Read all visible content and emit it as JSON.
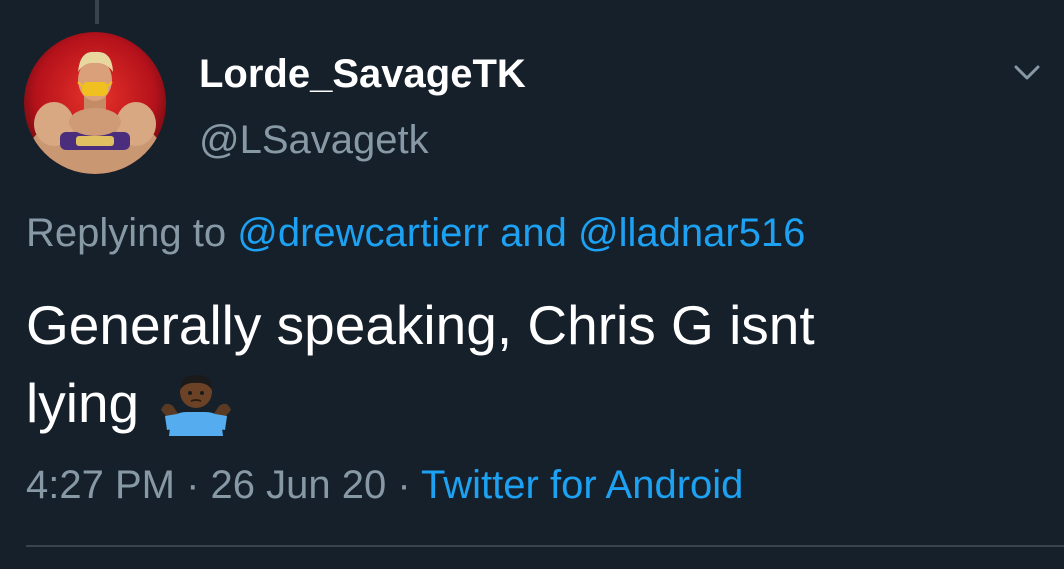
{
  "tweet": {
    "display_name": "Lorde_SavageTK",
    "handle": "@LSavagetk",
    "replying_prefix": "Replying to ",
    "reply_mention_1": "@drewcartierr",
    "reply_connector": " and ",
    "reply_mention_2": "@lladnar516",
    "text_line_1": "Generally speaking, Chris G isnt",
    "text_line_2": "lying",
    "emoji": "person-shrugging-emoji",
    "time": "4:27 PM",
    "separator": " · ",
    "date": "26 Jun 20",
    "source": "Twitter for Android"
  },
  "icons": {
    "menu": "chevron-down-icon",
    "avatar": "avatar-image"
  },
  "colors": {
    "background": "#15202b",
    "primary_text": "#ffffff",
    "secondary_text": "#8899a6",
    "link": "#1da1f2",
    "divider": "#38444d"
  }
}
